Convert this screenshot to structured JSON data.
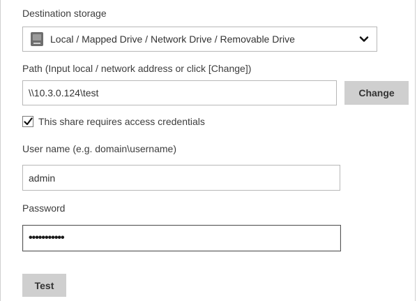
{
  "destination": {
    "label": "Destination storage",
    "selected": "Local / Mapped Drive / Network Drive / Removable Drive",
    "icon": "drive-icon"
  },
  "path": {
    "label": "Path (Input local / network address or click [Change])",
    "value": "\\\\10.3.0.124\\test",
    "change_button": "Change"
  },
  "credentials": {
    "checkbox_label": "This share requires access credentials",
    "checked": true
  },
  "username": {
    "label": "User name (e.g. domain\\username)",
    "value": "admin"
  },
  "password": {
    "label": "Password",
    "masked_value": "•••••••••••"
  },
  "test_button": "Test"
}
